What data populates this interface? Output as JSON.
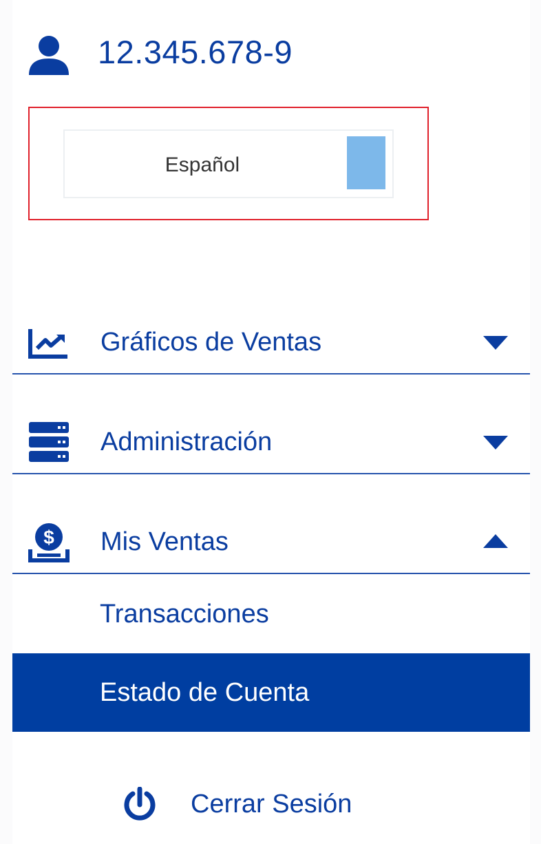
{
  "user": {
    "id": "12.345.678-9",
    "icon": "user-icon"
  },
  "language_select": {
    "value": "Español",
    "swatch_color": "#7db8ea",
    "highlight_color": "#e0202b"
  },
  "menu": [
    {
      "label": "Gráficos de Ventas",
      "icon": "chart-line-icon",
      "expanded": false
    },
    {
      "label": "Administración",
      "icon": "server-icon",
      "expanded": false
    },
    {
      "label": "Mis Ventas",
      "icon": "dollar-coin-icon",
      "expanded": true
    }
  ],
  "submenu": [
    {
      "label": "Transacciones",
      "active": false
    },
    {
      "label": "Estado de Cuenta",
      "active": true
    }
  ],
  "logout": {
    "label": "Cerrar Sesión",
    "icon": "power-icon"
  },
  "colors": {
    "brand": "#0a3da0",
    "active_bg": "#003ea1",
    "active_text": "#ffffff"
  }
}
